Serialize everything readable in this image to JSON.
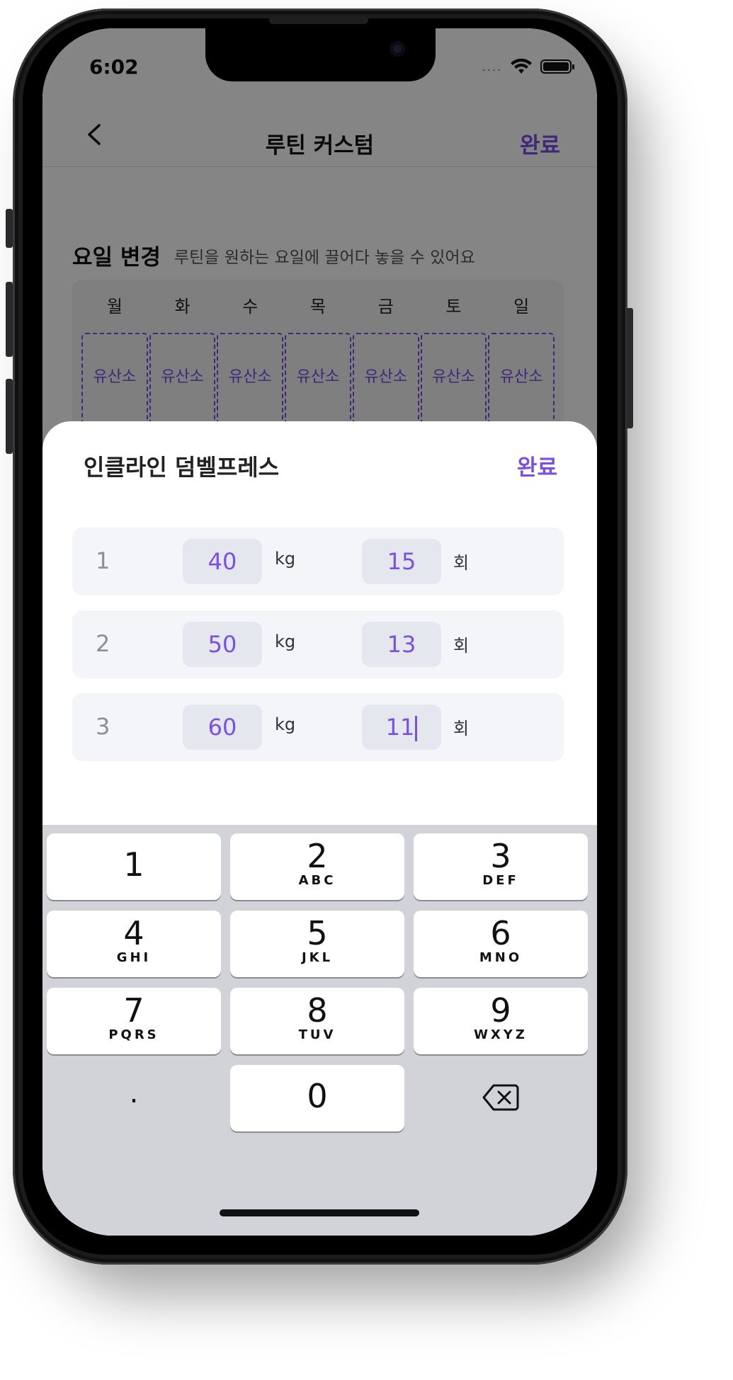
{
  "status": {
    "time": "6:02",
    "signal": "....",
    "icons": [
      "wifi-icon",
      "battery-icon"
    ]
  },
  "nav": {
    "title": "루틴 커스텀",
    "done": "완료"
  },
  "schedule": {
    "title": "요일 변경",
    "subtitle": "루틴을 원하는 요일에 끌어다 놓을 수 있어요",
    "days": [
      "월",
      "화",
      "수",
      "목",
      "금",
      "토",
      "일"
    ],
    "cells": [
      "유산소",
      "유산소",
      "유산소",
      "유산소",
      "유산소",
      "유산소",
      "유산소"
    ]
  },
  "sheet": {
    "title": "인클라인 덤벨프레스",
    "done": "완료",
    "weight_unit": "kg",
    "reps_unit": "회",
    "sets": [
      {
        "num": "1",
        "weight": "40",
        "reps": "15"
      },
      {
        "num": "2",
        "weight": "50",
        "reps": "13"
      },
      {
        "num": "3",
        "weight": "60",
        "reps": "11"
      }
    ]
  },
  "keypad": {
    "keys": [
      {
        "digit": "1",
        "letters": ""
      },
      {
        "digit": "2",
        "letters": "ABC"
      },
      {
        "digit": "3",
        "letters": "DEF"
      },
      {
        "digit": "4",
        "letters": "GHI"
      },
      {
        "digit": "5",
        "letters": "JKL"
      },
      {
        "digit": "6",
        "letters": "MNO"
      },
      {
        "digit": "7",
        "letters": "PQRS"
      },
      {
        "digit": "8",
        "letters": "TUV"
      },
      {
        "digit": "9",
        "letters": "WXYZ"
      }
    ],
    "dot": ".",
    "zero": "0",
    "delete_icon": "backspace-icon"
  },
  "colors": {
    "accent": "#7b4ee6",
    "sheet_row": "#f4f5f8",
    "value_box": "#e5e7ee",
    "keypad_bg": "#d1d3d9"
  }
}
